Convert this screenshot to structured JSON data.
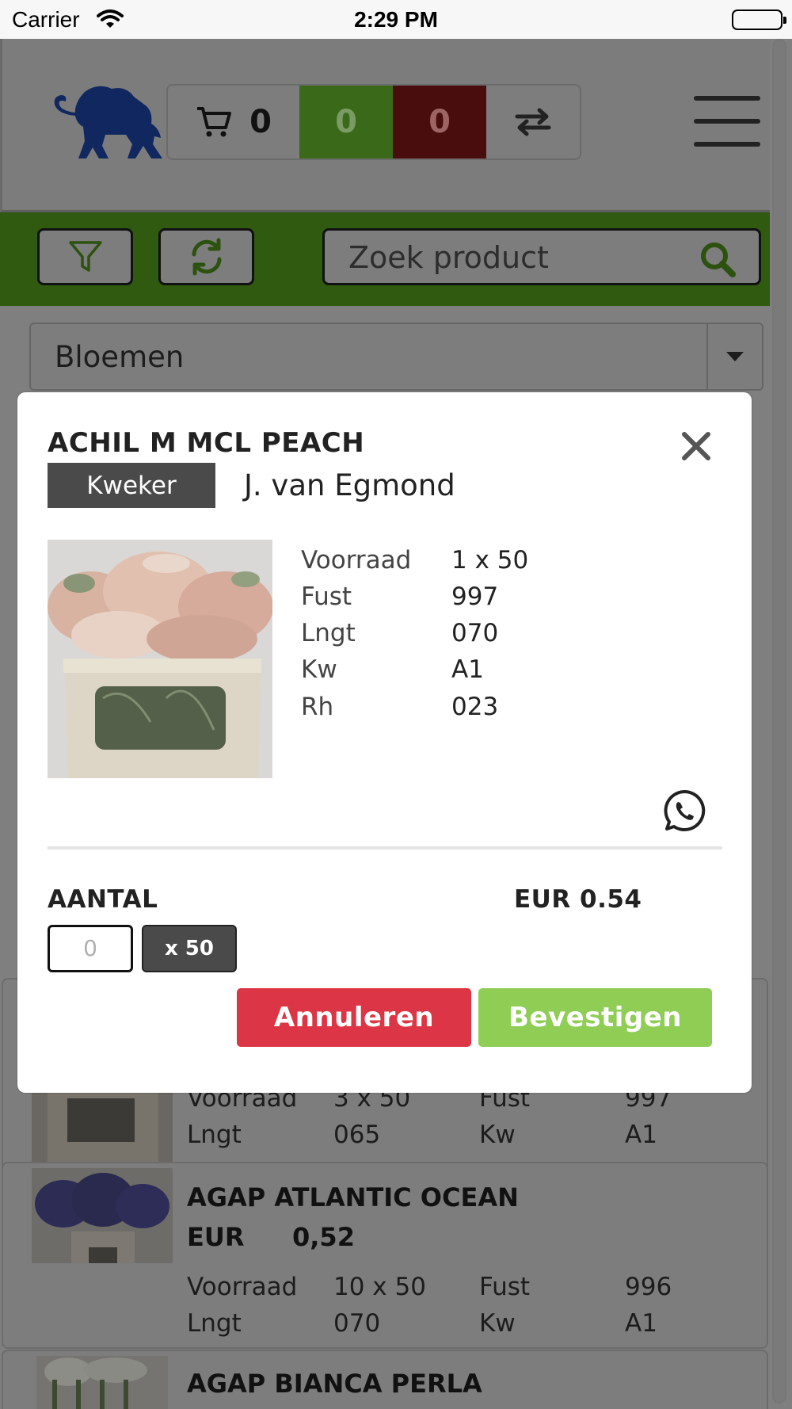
{
  "status_bar": {
    "carrier": "Carrier",
    "time": "2:29 PM"
  },
  "header": {
    "cart_count": "0",
    "green_count": "0",
    "red_count": "0"
  },
  "toolbar": {
    "search_placeholder": "Zoek product"
  },
  "category": {
    "selected": "Bloemen"
  },
  "list": [
    {
      "name": "",
      "specs": {
        "voorraad_label": "Voorraad",
        "voorraad": "3 x 50",
        "fust_label": "Fust",
        "fust": "997",
        "lngt_label": "Lngt",
        "lngt": "065",
        "kw_label": "Kw",
        "kw": "A1"
      }
    },
    {
      "name": "AGAP ATLANTIC OCEAN",
      "currency": "EUR",
      "price": "0,52",
      "specs": {
        "voorraad_label": "Voorraad",
        "voorraad": "10 x 50",
        "fust_label": "Fust",
        "fust": "996",
        "lngt_label": "Lngt",
        "lngt": "070",
        "kw_label": "Kw",
        "kw": "A1"
      }
    },
    {
      "name": "AGAP BIANCA PERLA"
    }
  ],
  "modal": {
    "title": "ACHIL M MCL PEACH",
    "badge": "Kweker",
    "grower": "J. van Egmond",
    "specs": [
      {
        "label": "Voorraad",
        "value": "1 x 50"
      },
      {
        "label": "Fust",
        "value": "997"
      },
      {
        "label": "Lngt",
        "value": "070"
      },
      {
        "label": "Kw",
        "value": "A1"
      },
      {
        "label": "Rh",
        "value": "023"
      }
    ],
    "quantity_label": "AANTAL",
    "price": "EUR 0.54",
    "quantity_value": "0",
    "multiplier": "x 50",
    "cancel_label": "Annuleren",
    "confirm_label": "Bevestigen"
  },
  "colors": {
    "confirm": "#8fcd55",
    "cancel": "#dc3545",
    "toolbar_green": "#5aa31f",
    "logo": "#10285f"
  },
  "icons": [
    "wifi-icon",
    "battery-icon",
    "lion-logo",
    "cart-icon",
    "swap-icon",
    "menu-icon",
    "filter-icon",
    "refresh-icon",
    "search-icon",
    "chevron-down-icon",
    "close-icon",
    "whatsapp-icon"
  ]
}
